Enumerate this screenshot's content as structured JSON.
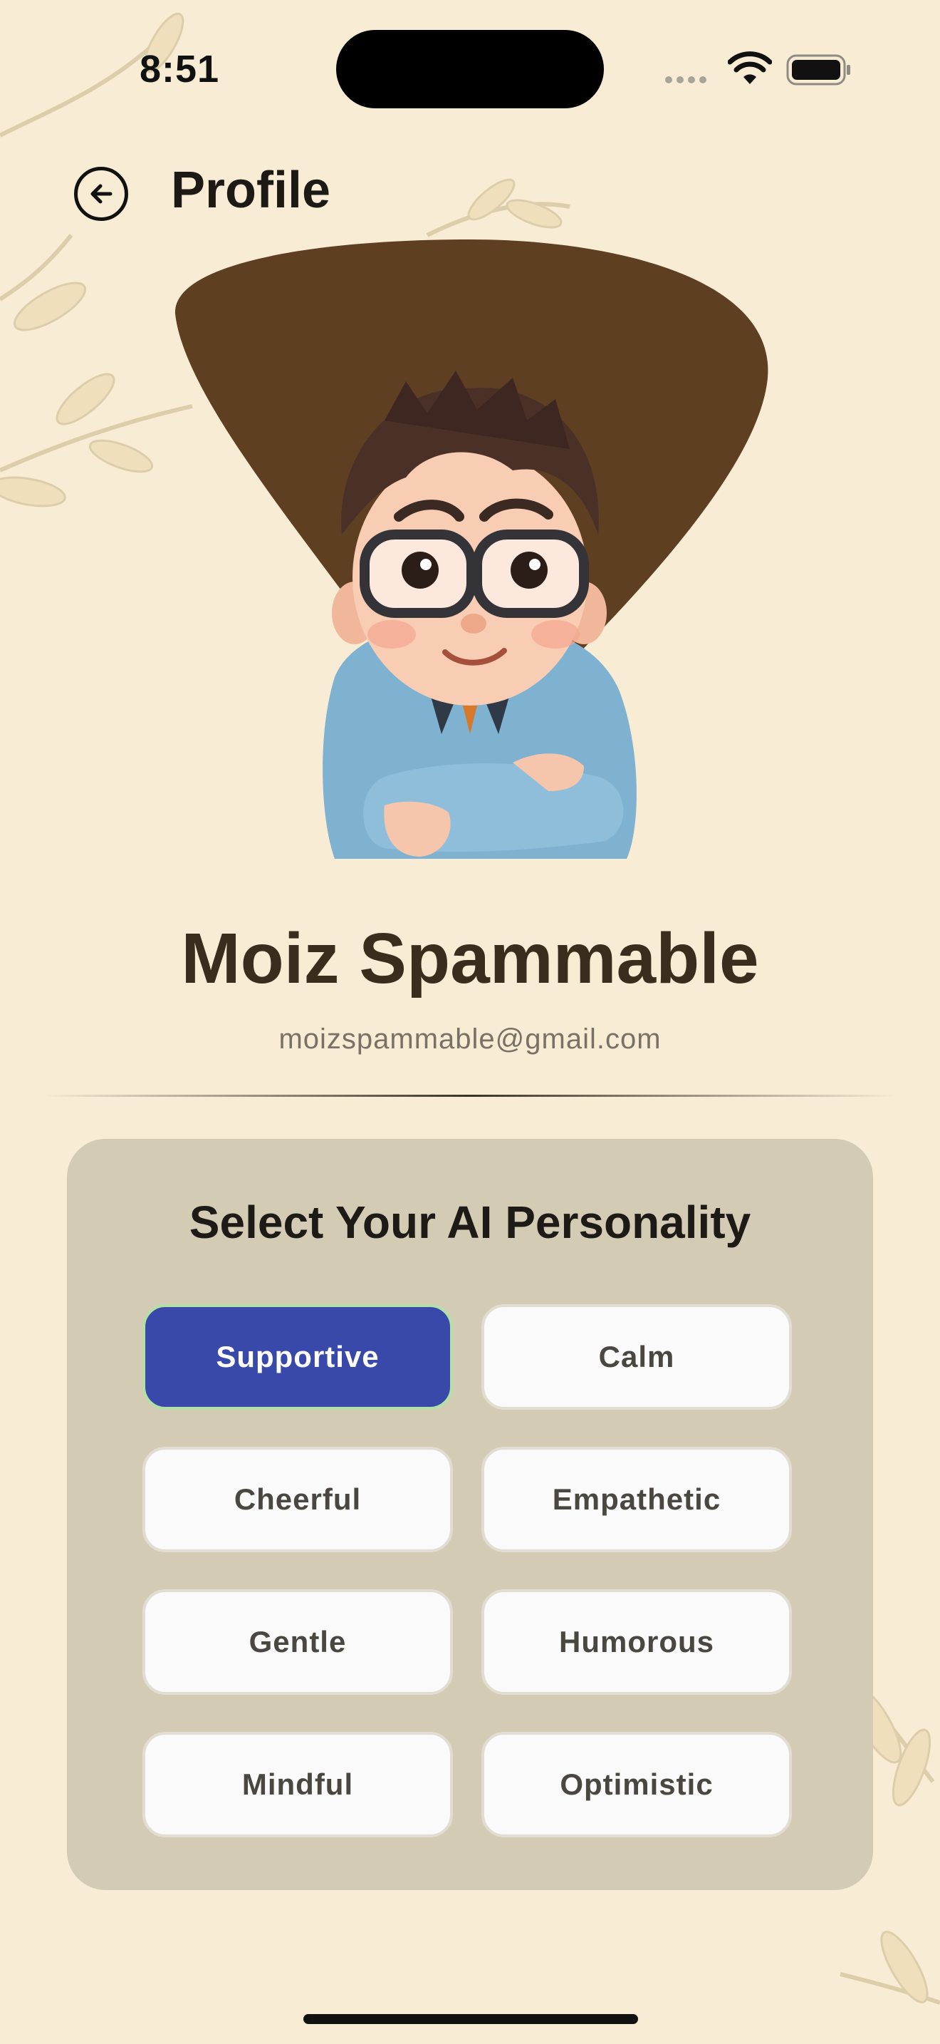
{
  "status_bar": {
    "time": "8:51"
  },
  "header": {
    "title": "Profile"
  },
  "profile": {
    "name": "Moiz Spammable",
    "email": "moizspammable@gmail.com"
  },
  "personality": {
    "title": "Select Your AI Personality",
    "selected": "Supportive",
    "options": [
      "Supportive",
      "Calm",
      "Cheerful",
      "Empathetic",
      "Gentle",
      "Humorous",
      "Mindful",
      "Optimistic"
    ]
  },
  "colors": {
    "background": "#f8ecd4",
    "card": "#d4cbb5",
    "selected_option": "#3949a9",
    "avatar_backdrop": "#5e3f22"
  },
  "icons": {
    "back": "arrow-left-circle-icon",
    "wifi": "wifi-icon",
    "battery": "battery-icon",
    "signal": "signal-dots-icon"
  }
}
